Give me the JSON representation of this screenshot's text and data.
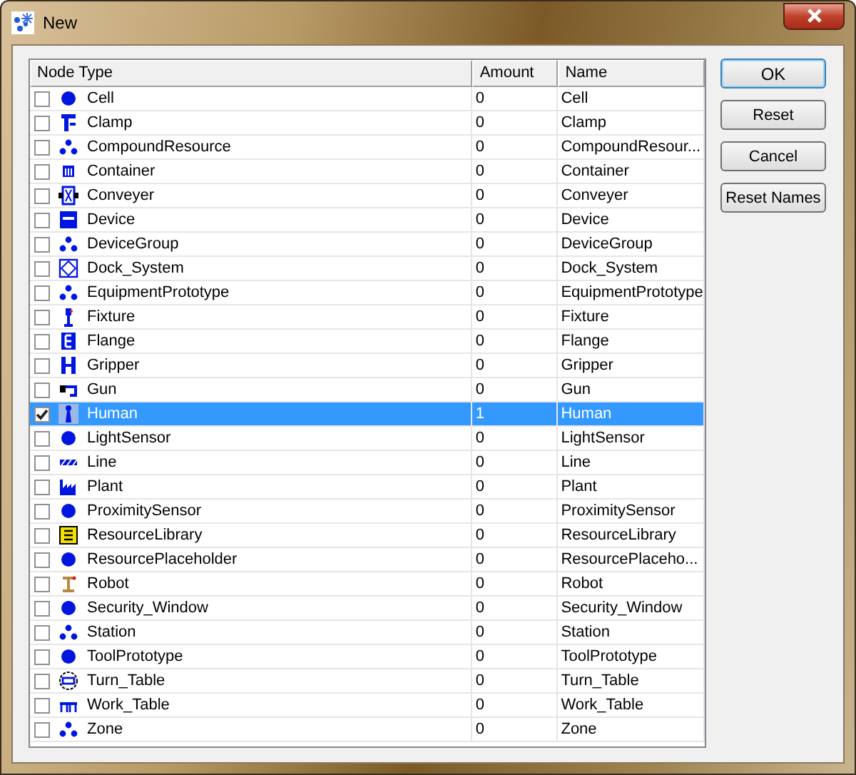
{
  "window": {
    "title": "New"
  },
  "table": {
    "columns": [
      "Node Type",
      "Amount",
      "Name"
    ],
    "rows": [
      {
        "node_type": "Cell",
        "checked": false,
        "selected": false,
        "amount": "0",
        "name": "Cell"
      },
      {
        "node_type": "Clamp",
        "checked": false,
        "selected": false,
        "amount": "0",
        "name": "Clamp"
      },
      {
        "node_type": "CompoundResource",
        "checked": false,
        "selected": false,
        "amount": "0",
        "name": "CompoundResour..."
      },
      {
        "node_type": "Container",
        "checked": false,
        "selected": false,
        "amount": "0",
        "name": "Container"
      },
      {
        "node_type": "Conveyer",
        "checked": false,
        "selected": false,
        "amount": "0",
        "name": "Conveyer"
      },
      {
        "node_type": "Device",
        "checked": false,
        "selected": false,
        "amount": "0",
        "name": "Device"
      },
      {
        "node_type": "DeviceGroup",
        "checked": false,
        "selected": false,
        "amount": "0",
        "name": "DeviceGroup"
      },
      {
        "node_type": "Dock_System",
        "checked": false,
        "selected": false,
        "amount": "0",
        "name": "Dock_System"
      },
      {
        "node_type": "EquipmentPrototype",
        "checked": false,
        "selected": false,
        "amount": "0",
        "name": "EquipmentPrototype"
      },
      {
        "node_type": "Fixture",
        "checked": false,
        "selected": false,
        "amount": "0",
        "name": "Fixture"
      },
      {
        "node_type": "Flange",
        "checked": false,
        "selected": false,
        "amount": "0",
        "name": "Flange"
      },
      {
        "node_type": "Gripper",
        "checked": false,
        "selected": false,
        "amount": "0",
        "name": "Gripper"
      },
      {
        "node_type": "Gun",
        "checked": false,
        "selected": false,
        "amount": "0",
        "name": "Gun"
      },
      {
        "node_type": "Human",
        "checked": true,
        "selected": true,
        "amount": "1",
        "name": "Human"
      },
      {
        "node_type": "LightSensor",
        "checked": false,
        "selected": false,
        "amount": "0",
        "name": "LightSensor"
      },
      {
        "node_type": "Line",
        "checked": false,
        "selected": false,
        "amount": "0",
        "name": "Line"
      },
      {
        "node_type": "Plant",
        "checked": false,
        "selected": false,
        "amount": "0",
        "name": "Plant"
      },
      {
        "node_type": "ProximitySensor",
        "checked": false,
        "selected": false,
        "amount": "0",
        "name": "ProximitySensor"
      },
      {
        "node_type": "ResourceLibrary",
        "checked": false,
        "selected": false,
        "amount": "0",
        "name": "ResourceLibrary"
      },
      {
        "node_type": "ResourcePlaceholder",
        "checked": false,
        "selected": false,
        "amount": "0",
        "name": "ResourcePlaceho..."
      },
      {
        "node_type": "Robot",
        "checked": false,
        "selected": false,
        "amount": "0",
        "name": "Robot"
      },
      {
        "node_type": "Security_Window",
        "checked": false,
        "selected": false,
        "amount": "0",
        "name": "Security_Window"
      },
      {
        "node_type": "Station",
        "checked": false,
        "selected": false,
        "amount": "0",
        "name": "Station"
      },
      {
        "node_type": "ToolPrototype",
        "checked": false,
        "selected": false,
        "amount": "0",
        "name": "ToolPrototype"
      },
      {
        "node_type": "Turn_Table",
        "checked": false,
        "selected": false,
        "amount": "0",
        "name": "Turn_Table"
      },
      {
        "node_type": "Work_Table",
        "checked": false,
        "selected": false,
        "amount": "0",
        "name": "Work_Table"
      },
      {
        "node_type": "Zone",
        "checked": false,
        "selected": false,
        "amount": "0",
        "name": "Zone"
      }
    ]
  },
  "buttons": [
    "OK",
    "Reset",
    "Cancel",
    "Reset Names"
  ]
}
